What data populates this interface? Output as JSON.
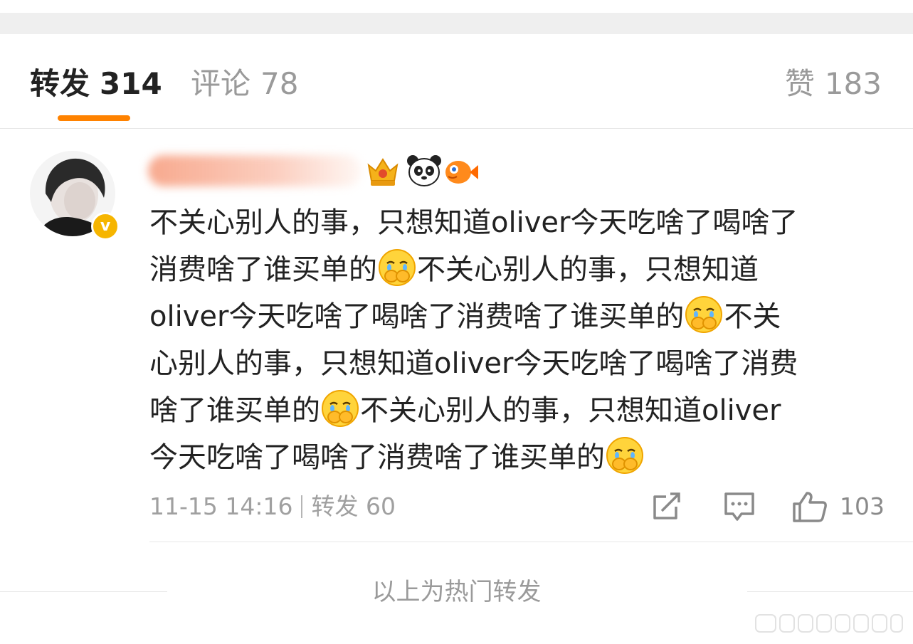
{
  "tabs": [
    {
      "label": "转发",
      "count": "314",
      "active": true
    },
    {
      "label": "评论",
      "count": "78",
      "active": false
    },
    {
      "label": "赞",
      "count": "183",
      "active": false
    }
  ],
  "colors": {
    "accent": "#ff8200",
    "verified": "#f6b500",
    "text": "#222222",
    "muted": "#9a9a9a"
  },
  "post": {
    "author": {
      "avatar_icon": "avatar-photo",
      "verified_icon": "verified-v-icon",
      "badges": [
        "crown-badge-icon",
        "panda-badge-icon",
        "fish-badge-icon"
      ]
    },
    "lines": [
      {
        "text": "不关心别人的事，只想知道oliver今天吃啥了喝啥了"
      },
      {
        "text": "消费啥了谁买单的",
        "emoji": "crying-cover-mouth-emoji",
        "after": "不关心别人的事，只想知道"
      },
      {
        "text": "oliver今天吃啥了喝啥了消费啥了谁买单的",
        "emoji": "crying-cover-mouth-emoji",
        "after": "不关"
      },
      {
        "text": "心别人的事，只想知道oliver今天吃啥了喝啥了消费"
      },
      {
        "text": "啥了谁买单的",
        "emoji": "crying-cover-mouth-emoji",
        "after": "不关心别人的事，只想知道oliver"
      },
      {
        "text": "今天吃啥了喝啥了消费啥了谁买单的",
        "emoji": "crying-cover-mouth-emoji",
        "after": ""
      }
    ],
    "timestamp": "11-15 14:16",
    "repost_label": "转发",
    "repost_count": "60",
    "like_count": "103"
  },
  "footer": {
    "hot_label": "以上为热门转发"
  }
}
